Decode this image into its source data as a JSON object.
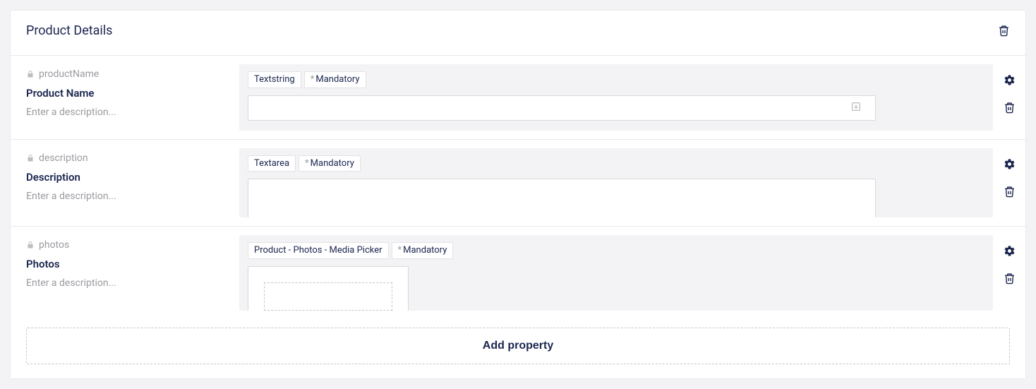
{
  "panel": {
    "title": "Product Details",
    "add_property_label": "Add property"
  },
  "icons": {
    "trash": "trash-icon",
    "gear": "gear-icon",
    "lock": "lock-icon",
    "keyboard": "keyboard-down-icon"
  },
  "properties": [
    {
      "alias": "productName",
      "label": "Product Name",
      "desc_placeholder": "Enter a description...",
      "type_badge": "Textstring",
      "mandatory_label": "Mandatory",
      "editor": "textstring",
      "value": ""
    },
    {
      "alias": "description",
      "label": "Description",
      "desc_placeholder": "Enter a description...",
      "type_badge": "Textarea",
      "mandatory_label": "Mandatory",
      "editor": "textarea",
      "value": ""
    },
    {
      "alias": "photos",
      "label": "Photos",
      "desc_placeholder": "Enter a description...",
      "type_badge": "Product - Photos - Media Picker",
      "mandatory_label": "Mandatory",
      "editor": "media",
      "value": ""
    }
  ]
}
